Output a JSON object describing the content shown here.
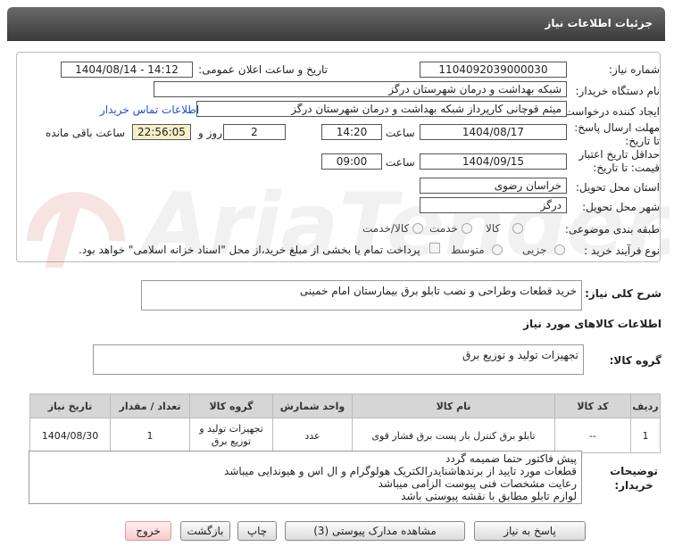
{
  "header": {
    "title": "جزئیات اطلاعات نیاز"
  },
  "fields": {
    "need_number_label": "شماره نیاز:",
    "need_number": "1104092039000030",
    "announce_label": "تاریخ و ساعت اعلان عمومی:",
    "announce_value": "1404/08/14 - 14:12",
    "buyer_org_label": "نام دستگاه خریدار:",
    "buyer_org": "شبکه بهداشت و درمان شهرستان درگز",
    "creator_label": "ایجاد کننده درخواست:",
    "creator": "میثم قوچانی کارپرداز شبکه بهداشت و درمان شهرستان درگز",
    "contact_link": "اطلاعات تماس خریدار",
    "deadline_label": "مهلت ارسال پاسخ: تا تاریخ:",
    "deadline_date": "1404/08/17",
    "time_label": "ساعت",
    "deadline_time": "14:20",
    "days_value": "2",
    "days_label": "روز و",
    "remaining_time": "22:56:05",
    "remaining_label": "ساعت باقی مانده",
    "validity_label": "حداقل تاریخ اعتبار قیمت: تا تاریخ:",
    "validity_date": "1404/09/15",
    "validity_time": "09:00",
    "province_label": "استان محل تحویل:",
    "province": "خراسان رضوی",
    "city_label": "شهر محل تحویل:",
    "city": "درگز",
    "category_label": "طبقه بندی موضوعی:",
    "category_options": [
      "کالا",
      "خدمت",
      "کالا/خدمت"
    ],
    "process_label": "نوع فرآیند خرید :",
    "process_options": [
      "جزیی",
      "متوسط"
    ],
    "payment_note": "پرداخت تمام یا بخشی از مبلغ خرید،از محل \"اسناد خزانه اسلامی\" خواهد بود."
  },
  "description": {
    "label": "شرح کلی نیاز:",
    "value": "خرید قطعات وطراحی و نصب تابلو برق بیمارستان امام خمینی"
  },
  "goods_info": {
    "title": "اطلاعات کالاهای مورد نیاز",
    "group_label": "گروه کالا:",
    "group_value": "تجهیزات تولید و توزیع برق"
  },
  "table": {
    "headers": [
      "ردیف",
      "کد کالا",
      "نام کالا",
      "واحد شمارش",
      "گروه کالا",
      "تعداد / مقدار",
      "تاریخ نیاز"
    ],
    "rows": [
      [
        "1",
        "--",
        "تابلو برق کنترل بار پست برق فشار قوی",
        "عدد",
        "تجهیزات تولید و توزیع برق",
        "1",
        "1404/08/30"
      ]
    ]
  },
  "buyer_notes": {
    "label": "توضیحات خریدار:",
    "lines": [
      "پیش فاکتور حتما ضمیمه گردد",
      "قطعات مورد تایید از برندهاشنایدرالکتریک هولوگرام و ال اس و هیوندایی میباشد",
      "رعایت مشخصات فنی پیوست الزامی میباشد",
      "لوازم تابلو مطابق با نقشه پیوستی باشد"
    ]
  },
  "buttons": {
    "reply": "پاسخ به نیاز",
    "attachments": "مشاهده مدارک پیوستی (3)",
    "print": "چاپ",
    "back": "بازگشت",
    "exit": "خروج"
  },
  "watermark": {
    "text": "AriaTender.net"
  },
  "colors": {
    "header": "#4a4a4a",
    "link": "#1a4fd0",
    "remaining_bg": "#f5f0c8",
    "exit_bg": "#f7c9c9"
  }
}
